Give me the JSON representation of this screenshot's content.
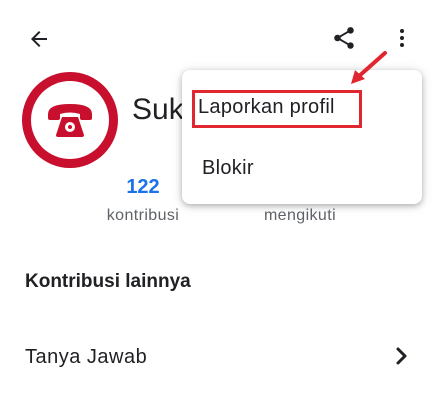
{
  "toolbar": {
    "back_icon": "arrow-back-icon",
    "share_icon": "share-icon",
    "more_icon": "more-vert-icon"
  },
  "profile": {
    "avatar_icon": "telephone-icon",
    "name": "Suk",
    "stats": [
      {
        "value": "122",
        "label": "kontribusi"
      },
      {
        "label": "mengikuti"
      }
    ]
  },
  "section": {
    "title": "Kontribusi lainnya",
    "item_label": "Tanya Jawab",
    "item_icon": "chevron-right-icon"
  },
  "menu": {
    "items": [
      {
        "label": "Laporkan profil"
      },
      {
        "label": "Blokir"
      }
    ],
    "highlight_color": "#e0262f"
  },
  "colors": {
    "accent_blue": "#1a73e8",
    "avatar_red": "#c8102e"
  }
}
